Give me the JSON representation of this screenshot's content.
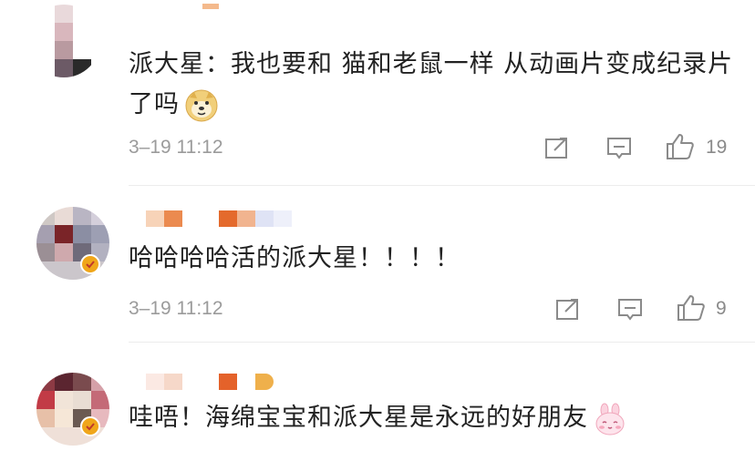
{
  "comments": [
    {
      "text": "派大星：我也要和 猫和老鼠一样 从动画片变成纪录片了吗",
      "emoji": "doge-emoji",
      "time": "3–19 11:12",
      "likes": "19",
      "verified": false
    },
    {
      "text": "哈哈哈哈活的派大星！！！！",
      "time": "3–19 11:12",
      "likes": "9",
      "verified": true
    },
    {
      "text": "哇唔！海绵宝宝和派大星是永远的好朋友",
      "emoji": "pink-bunny-emoji",
      "verified": true
    }
  ],
  "colors": {
    "verified_badge": "#f0a61a",
    "text": "#222222",
    "meta": "#9b9b9b",
    "icon": "#8a8a8a"
  },
  "icons": [
    "share-icon",
    "comment-icon",
    "like-icon",
    "verified-icon",
    "doge-emoji",
    "pink-bunny-emoji"
  ]
}
